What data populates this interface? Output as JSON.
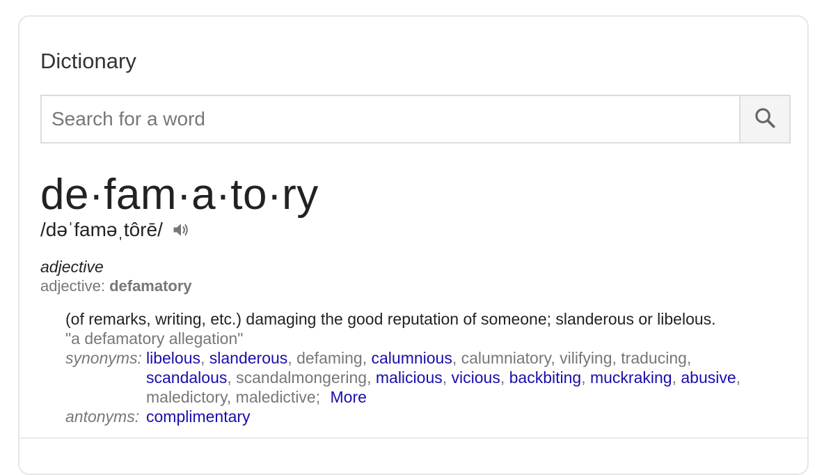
{
  "header": {
    "title": "Dictionary"
  },
  "search": {
    "placeholder": "Search for a word",
    "value": ""
  },
  "entry": {
    "word": "de·fam·a·to·ry",
    "phonetic": "/dəˈfaməˌtôrē/",
    "part_of_speech": "adjective",
    "forms_label": "adjective: ",
    "forms_value": "defamatory",
    "definition": "(of remarks, writing, etc.) damaging the good reputation of someone; slanderous or libelous.",
    "example": "\"a defamatory allegation\"",
    "synonyms_label": "synonyms:",
    "synonyms": [
      {
        "text": "libelous",
        "link": true
      },
      {
        "text": "slanderous",
        "link": true
      },
      {
        "text": "defaming",
        "link": false
      },
      {
        "text": "calumnious",
        "link": true
      },
      {
        "text": "calumniatory",
        "link": false
      },
      {
        "text": "vilifying",
        "link": false
      },
      {
        "text": "traducing",
        "link": false
      },
      {
        "text": "scandalous",
        "link": true
      },
      {
        "text": "scandalmongering",
        "link": false
      },
      {
        "text": "malicious",
        "link": true
      },
      {
        "text": "vicious",
        "link": true
      },
      {
        "text": "backbiting",
        "link": true
      },
      {
        "text": "muckraking",
        "link": true
      },
      {
        "text": "abusive",
        "link": true
      },
      {
        "text": "maledictory",
        "link": false
      },
      {
        "text": "maledictive",
        "link": false
      }
    ],
    "more_label": "More",
    "antonyms_label": "antonyms:",
    "antonyms": [
      {
        "text": "complimentary",
        "link": true
      }
    ]
  },
  "colors": {
    "link": "#1a0dab",
    "muted": "#777777",
    "text": "#222222"
  },
  "icons": {
    "search": "search-icon",
    "speaker": "speaker-icon"
  }
}
